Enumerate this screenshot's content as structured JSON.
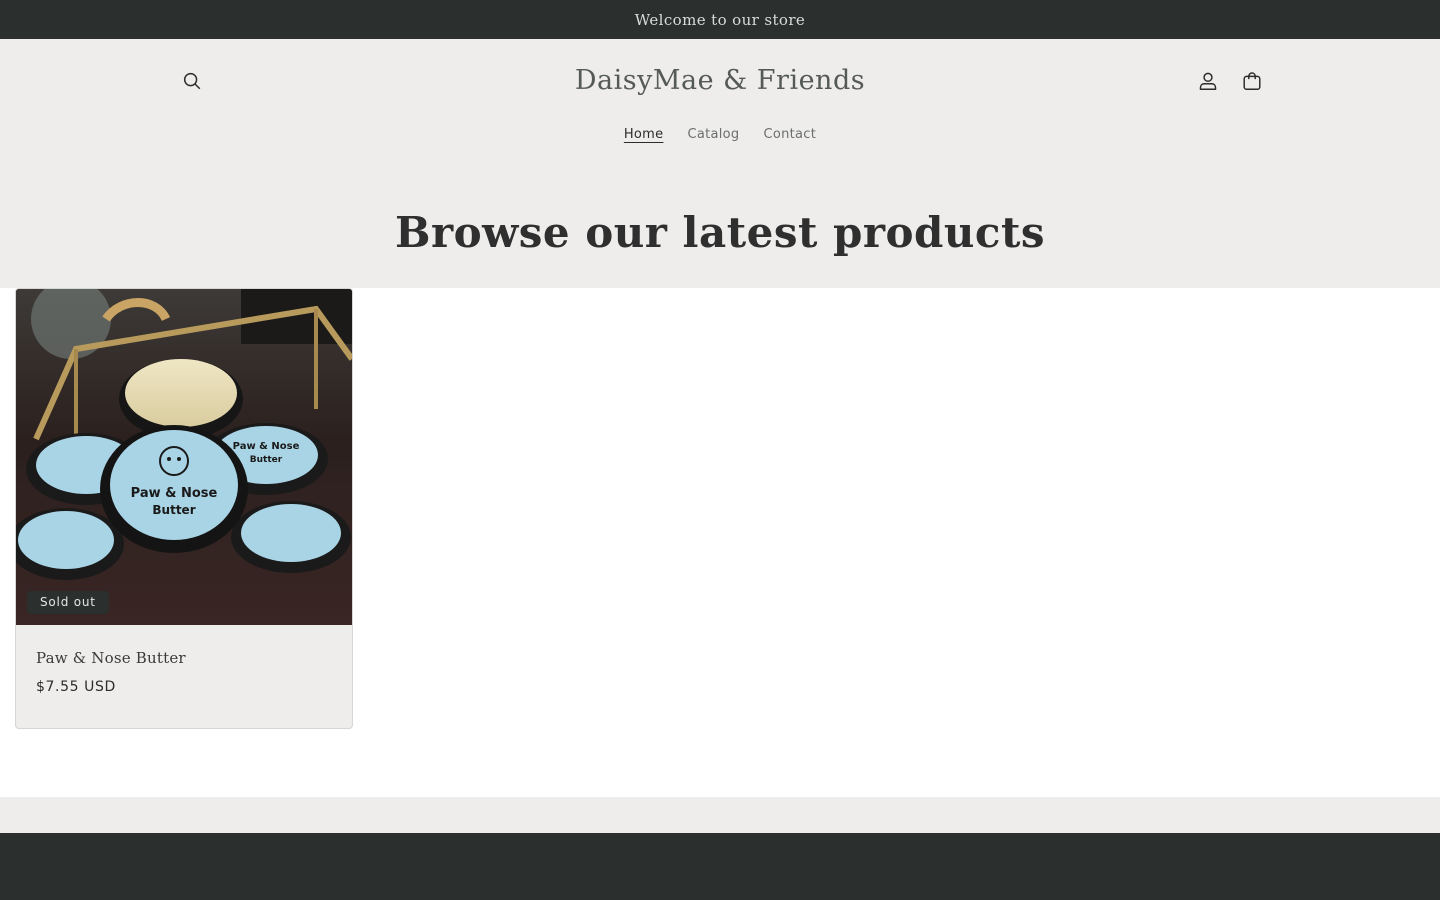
{
  "announcement": {
    "text": "Welcome to our store"
  },
  "header": {
    "store_name": "DaisyMae & Friends",
    "icons": {
      "search": "search-icon",
      "account": "account-icon",
      "cart": "cart-icon"
    },
    "nav": [
      {
        "label": "Home",
        "active": true
      },
      {
        "label": "Catalog",
        "active": false
      },
      {
        "label": "Contact",
        "active": false
      }
    ]
  },
  "collection": {
    "heading": "Browse our latest products",
    "products": [
      {
        "title": "Paw & Nose Butter",
        "price": "$7.55 USD",
        "badge": "Sold out",
        "image": {
          "label_line1": "Paw & Nose",
          "label_line2": "Butter",
          "tin_labels": [
            "Paw & Nose",
            "Butter"
          ]
        }
      }
    ]
  },
  "colors": {
    "announcement_bg": "#2b302e",
    "header_bg": "#eeedeb",
    "footer_bg": "#2b302e",
    "tin_label": "#a9d4e6"
  }
}
